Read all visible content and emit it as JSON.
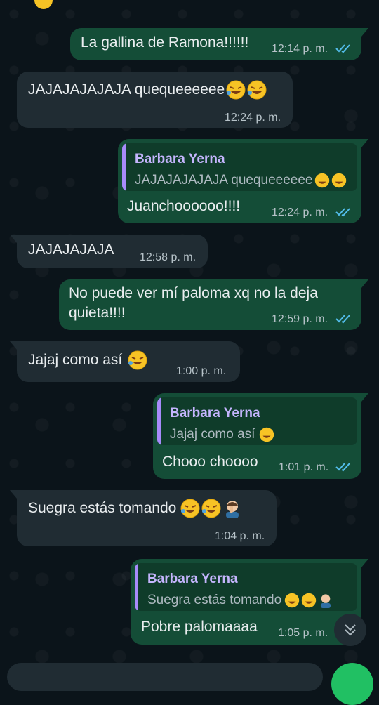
{
  "chat": {
    "messages": [
      {
        "text": "La gallina de Ramona!!!!!!",
        "time": "12:14 p. m."
      },
      {
        "text": "JAJAJAJAJAJA quequeeeeee",
        "time": "12:24 p. m."
      },
      {
        "quote_name": "Barbara Yerna",
        "quote_text": "JAJAJAJAJAJA quequeeeeee",
        "text": "Juanchoooooo!!!!",
        "time": "12:24 p. m."
      },
      {
        "text": "JAJAJAJAJA",
        "time": "12:58 p. m."
      },
      {
        "text": "No puede ver mí paloma xq no la deja quieta!!!!",
        "time": "12:59 p. m."
      },
      {
        "text": "Jajaj como así",
        "time": "1:00 p. m."
      },
      {
        "quote_name": "Barbara Yerna",
        "quote_text": "Jajaj como así",
        "text": "Chooo choooo",
        "time": "1:01 p. m."
      },
      {
        "text": "Suegra estás tomando",
        "time": "1:04 p. m."
      },
      {
        "quote_name": "Barbara Yerna",
        "quote_text": "Suegra estás tomando",
        "text": "Pobre palomaaaa",
        "time": "1:05 p. m."
      }
    ]
  },
  "icons": {
    "read_receipt": "double-check-icon",
    "laughing_emoji": "rolling-laughing-emoji",
    "facepalm_emoji": "facepalm-emoji",
    "scroll_down": "double-chevron-down-icon"
  },
  "colors": {
    "background": "#0b141a",
    "incoming_bubble": "#202c33",
    "outgoing_bubble": "#144d37",
    "read_ticks": "#53bdeb",
    "quote_name": "#c4b5fd"
  }
}
